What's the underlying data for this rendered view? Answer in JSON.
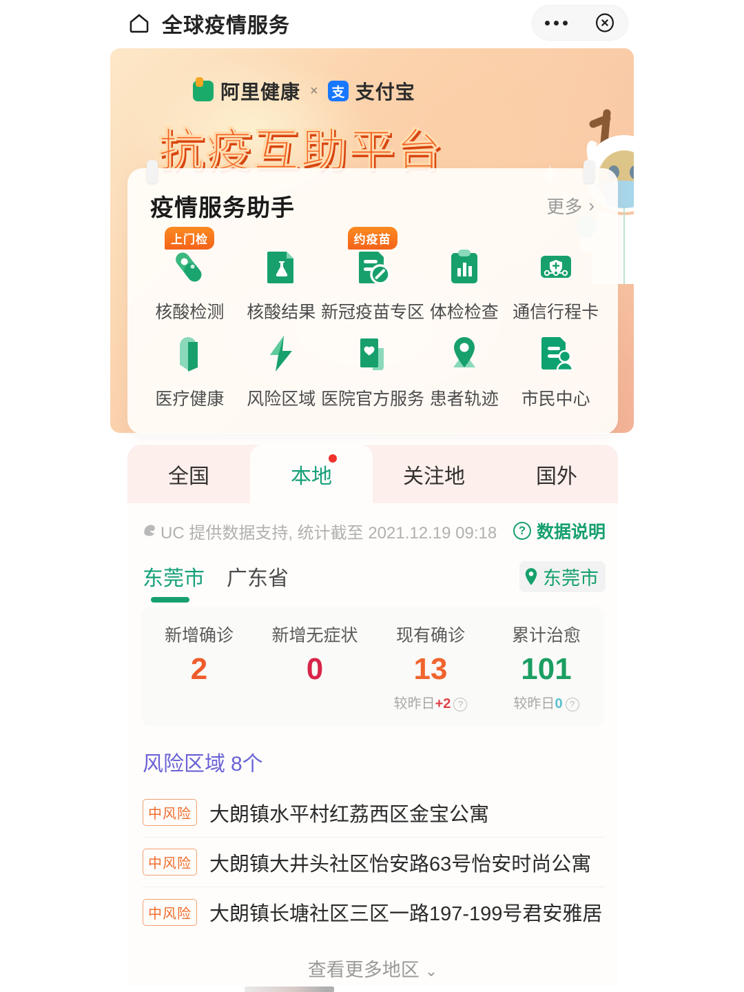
{
  "topbar": {
    "home_icon": "home-icon",
    "title": "全球疫情服务",
    "more_icon": "more-dots-icon",
    "close_icon": "close-circle-icon"
  },
  "banner": {
    "brand_ali": "阿里健康",
    "brand_sep": "×",
    "zfb_glyph": "支",
    "brand_zfb": "支付宝",
    "title": "抗疫互助平台",
    "mascot": "deer-mascot-in-hazmat-suit"
  },
  "service_card": {
    "title": "疫情服务助手",
    "more_label": "更多",
    "more_chevron": "›",
    "items": [
      {
        "label": "核酸检测",
        "icon": "test-tube-icon",
        "badge": "上门检"
      },
      {
        "label": "核酸结果",
        "icon": "lab-report-icon",
        "badge": ""
      },
      {
        "label": "新冠疫苗专区",
        "icon": "vaccine-form-icon",
        "badge": "约疫苗"
      },
      {
        "label": "体检检查",
        "icon": "clipboard-chart-icon",
        "badge": ""
      },
      {
        "label": "通信行程卡",
        "icon": "travel-card-icon",
        "badge": ""
      },
      {
        "label": "医疗健康",
        "icon": "heart-shield-icon",
        "badge": ""
      },
      {
        "label": "风险区域",
        "icon": "lightning-icon",
        "badge": ""
      },
      {
        "label": "医院官方服务",
        "icon": "hospital-heart-icon",
        "badge": ""
      },
      {
        "label": "患者轨迹",
        "icon": "map-pin-icon",
        "badge": ""
      },
      {
        "label": "市民中心",
        "icon": "citizen-center-icon",
        "badge": ""
      }
    ]
  },
  "tabs": {
    "items": [
      {
        "label": "全国",
        "active": false,
        "dot": false
      },
      {
        "label": "本地",
        "active": true,
        "dot": true
      },
      {
        "label": "关注地",
        "active": false,
        "dot": false
      },
      {
        "label": "国外",
        "active": false,
        "dot": false
      }
    ]
  },
  "source": {
    "icon": "uc-browser-icon",
    "text": "UC 提供数据支持, 统计截至 2021.12.19 09:18",
    "note_icon": "question-mark-icon",
    "note_label": "数据说明"
  },
  "region": {
    "tabs": [
      {
        "label": "东莞市",
        "active": true
      },
      {
        "label": "广东省",
        "active": false
      }
    ],
    "locate_icon": "location-pin-icon",
    "locate_label": "东莞市"
  },
  "stats": [
    {
      "label": "新增确诊",
      "value": "2",
      "color": "#ef5c2b",
      "delta_prefix": "",
      "delta_value": "",
      "has_delta": false
    },
    {
      "label": "新增无症状",
      "value": "0",
      "color": "#d8254a",
      "delta_prefix": "",
      "delta_value": "",
      "has_delta": false
    },
    {
      "label": "现有确诊",
      "value": "13",
      "color": "#f0642e",
      "delta_prefix": "较昨日",
      "delta_value": "+2",
      "delta_color": "#e0414b",
      "has_delta": true
    },
    {
      "label": "累计治愈",
      "value": "101",
      "color": "#1b9e62",
      "delta_prefix": "较昨日",
      "delta_value": "0",
      "delta_color": "#58c0cf",
      "has_delta": true
    }
  ],
  "risk": {
    "title": "风险区域",
    "count": "8个",
    "items": [
      {
        "level": "中风险",
        "address": "大朗镇水平村红荔西区金宝公寓"
      },
      {
        "level": "中风险",
        "address": "大朗镇大井头社区怡安路63号怡安时尚公寓"
      },
      {
        "level": "中风险",
        "address": "大朗镇长塘社区三区一路197-199号君安雅居"
      }
    ],
    "more_label": "查看更多地区",
    "more_chevron": "⌄"
  },
  "colors": {
    "accent_green": "#16a06e",
    "accent_orange": "#f4621f",
    "risk_purple": "#6a63d6",
    "tab_bg": "#fcefec"
  }
}
